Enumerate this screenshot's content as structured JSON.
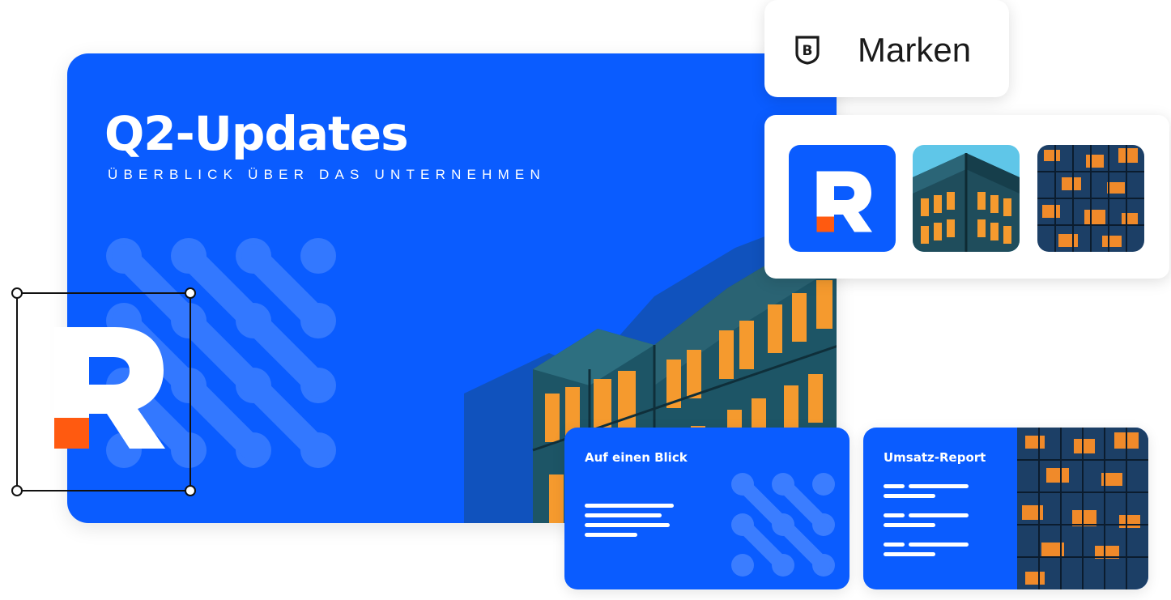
{
  "slide": {
    "title": "Q2-Updates",
    "subtitle": "ÜBERBLICK ÜBER DAS UNTERNEHMEN"
  },
  "brand_panel": {
    "label": "Marken",
    "icon": "b-shield-icon"
  },
  "asset_tiles": [
    {
      "kind": "logo",
      "icon": "r-logo-icon"
    },
    {
      "kind": "image",
      "icon": "building-corner-image"
    },
    {
      "kind": "image",
      "icon": "building-facade-image"
    }
  ],
  "cards": [
    {
      "title": "Auf einen Blick"
    },
    {
      "title": "Umsatz-Report"
    }
  ],
  "colors": {
    "brand_blue": "#0a5cff",
    "accent_orange": "#ff5a10",
    "window_amber": "#f59a2e",
    "facade_teal": "#1f4d5c"
  }
}
